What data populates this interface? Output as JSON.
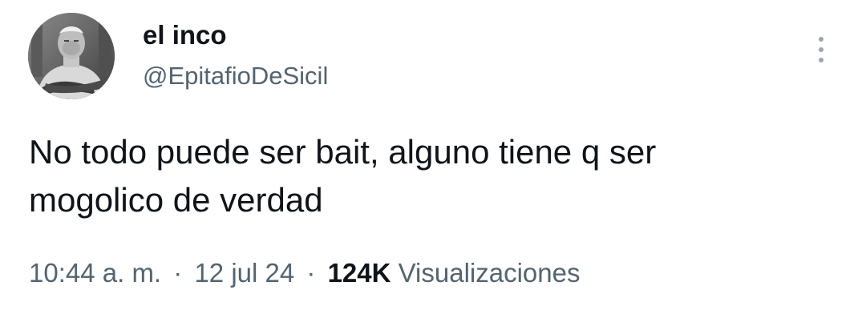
{
  "author": {
    "display_name": "el inco",
    "handle": "@EpitafioDeSicil",
    "avatar_icon": "profile-photo"
  },
  "tweet": {
    "text_lines": [
      "No todo puede ser bait, alguno tiene q ser",
      "mogolico de verdad"
    ]
  },
  "meta": {
    "time": "10:44 a. m.",
    "separator": "·",
    "date": "12 jul 24",
    "views_count": "124K",
    "views_label": "Visualizaciones"
  },
  "icons": {
    "more": "more-vertical-icon"
  },
  "colors": {
    "primary_text": "#0f1419",
    "secondary_text": "#536471",
    "background": "#ffffff"
  }
}
